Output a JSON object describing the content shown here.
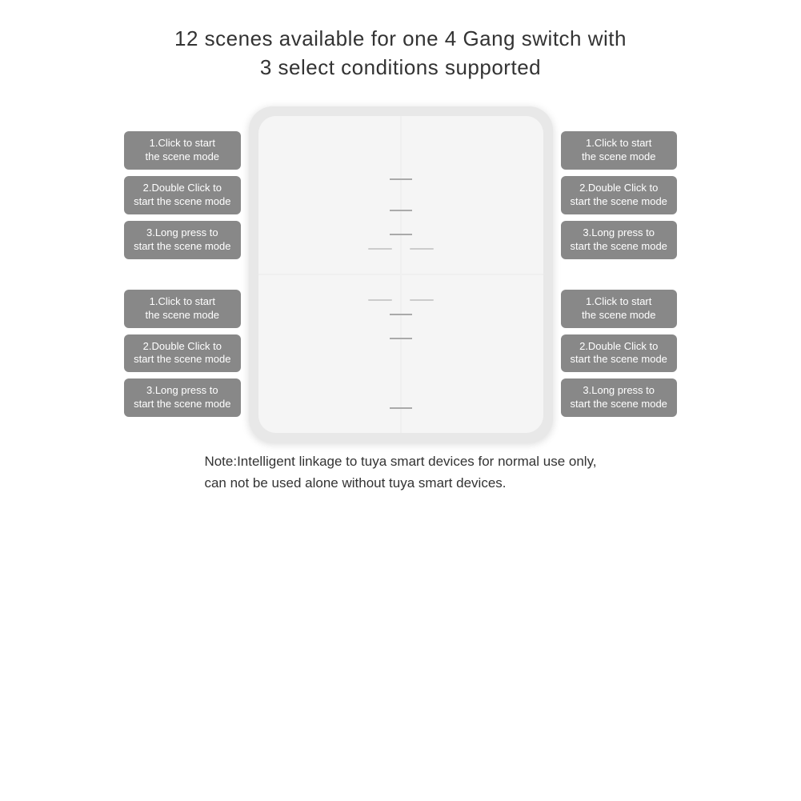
{
  "title": {
    "line1": "12 scenes available for one 4 Gang switch with",
    "line2": "3 select conditions supported"
  },
  "left_top_labels": [
    "1.Click to start\nthe scene mode",
    "2.Double Click to\nstart the scene mode",
    "3.Long press to\nstart the scene mode"
  ],
  "left_bottom_labels": [
    "1.Click to start\nthe scene mode",
    "2.Double Click to\nstart the scene mode",
    "3.Long press to\nstart the scene mode"
  ],
  "right_top_labels": [
    "1.Click to start\nthe scene mode",
    "2.Double Click to\nstart the scene mode",
    "3.Long press to\nstart the scene mode"
  ],
  "right_bottom_labels": [
    "1.Click to start\nthe scene mode",
    "2.Double Click to\nstart the scene mode",
    "3.Long press to\nstart the scene mode"
  ],
  "note": {
    "line1": "Note:Intelligent linkage to tuya smart devices for normal use only,",
    "line2": "can not be used alone without tuya smart devices."
  }
}
